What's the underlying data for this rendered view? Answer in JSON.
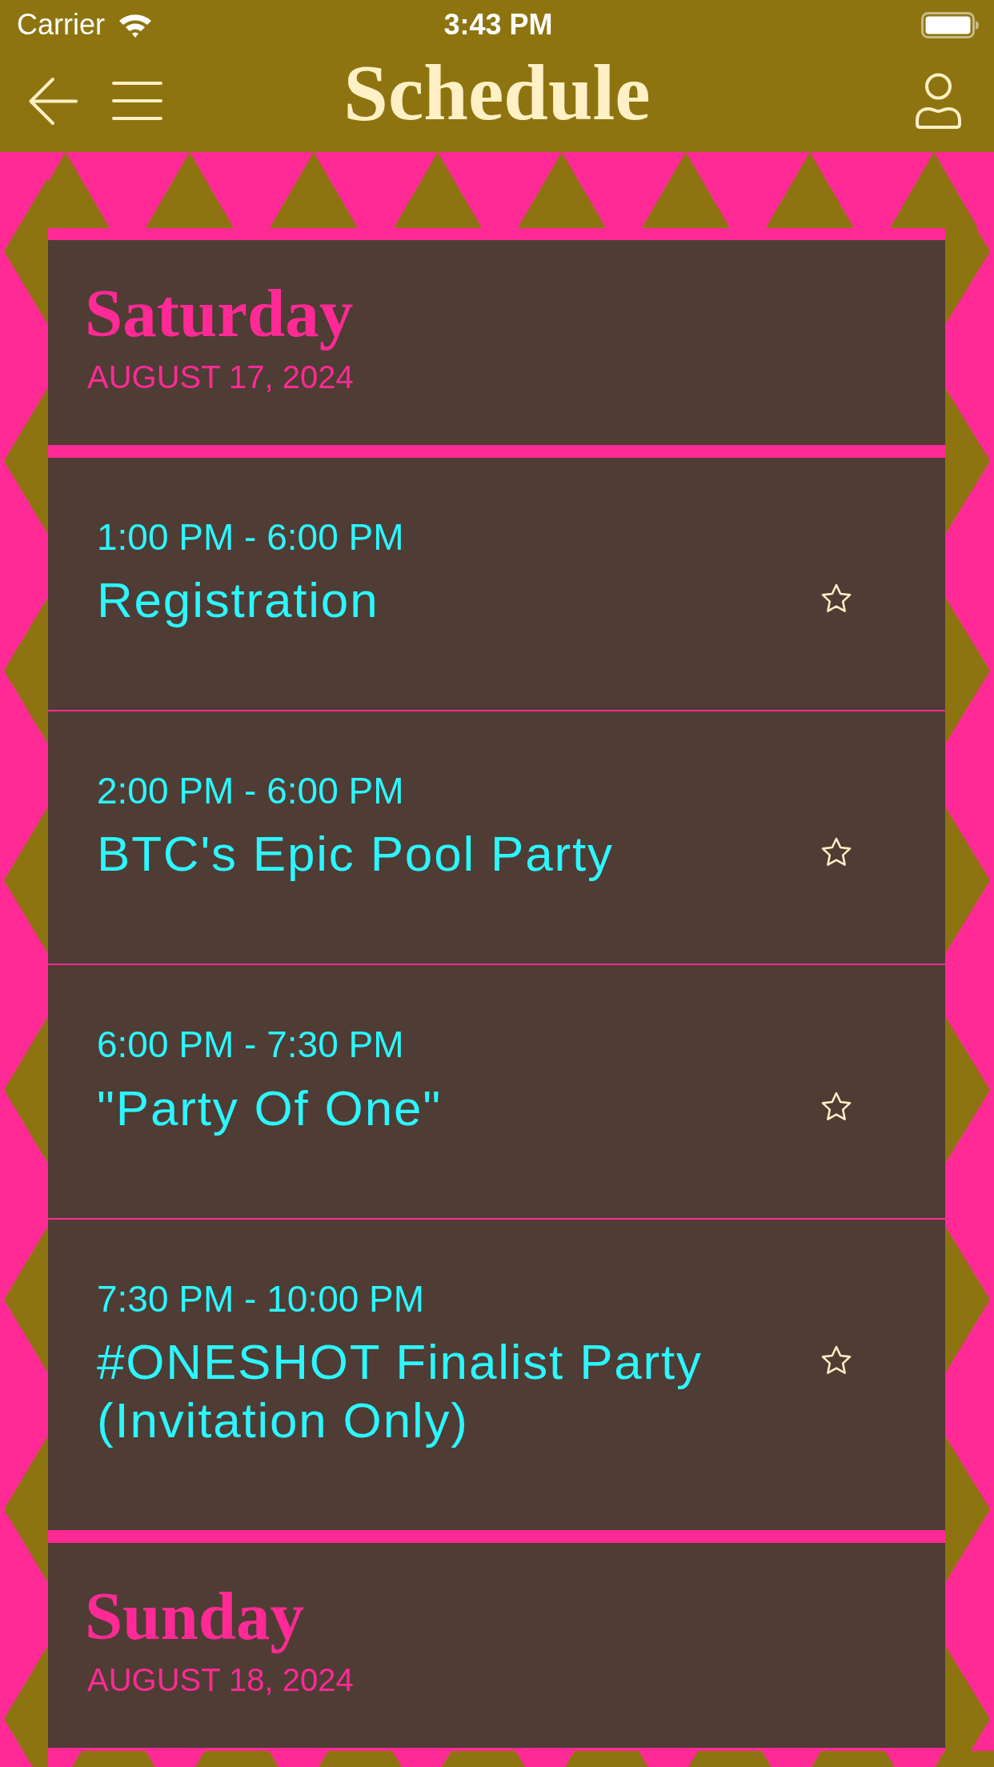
{
  "status_bar": {
    "carrier": "Carrier",
    "time": "3:43 PM"
  },
  "header": {
    "title": "Schedule"
  },
  "days": [
    {
      "name": "Saturday",
      "date": "AUGUST 17, 2024",
      "events": [
        {
          "time": "1:00 PM - 6:00 PM",
          "title": "Registration",
          "starred": false
        },
        {
          "time": "2:00 PM - 6:00 PM",
          "title": "BTC's Epic Pool Party",
          "starred": false
        },
        {
          "time": "6:00 PM - 7:30 PM",
          "title": "\"Party Of One\"",
          "starred": false
        },
        {
          "time": "7:30 PM - 10:00 PM",
          "title": "#ONESHOT Finalist Party (Invitation Only)",
          "starred": false
        }
      ]
    },
    {
      "name": "Sunday",
      "date": "AUGUST 18, 2024"
    }
  ]
}
